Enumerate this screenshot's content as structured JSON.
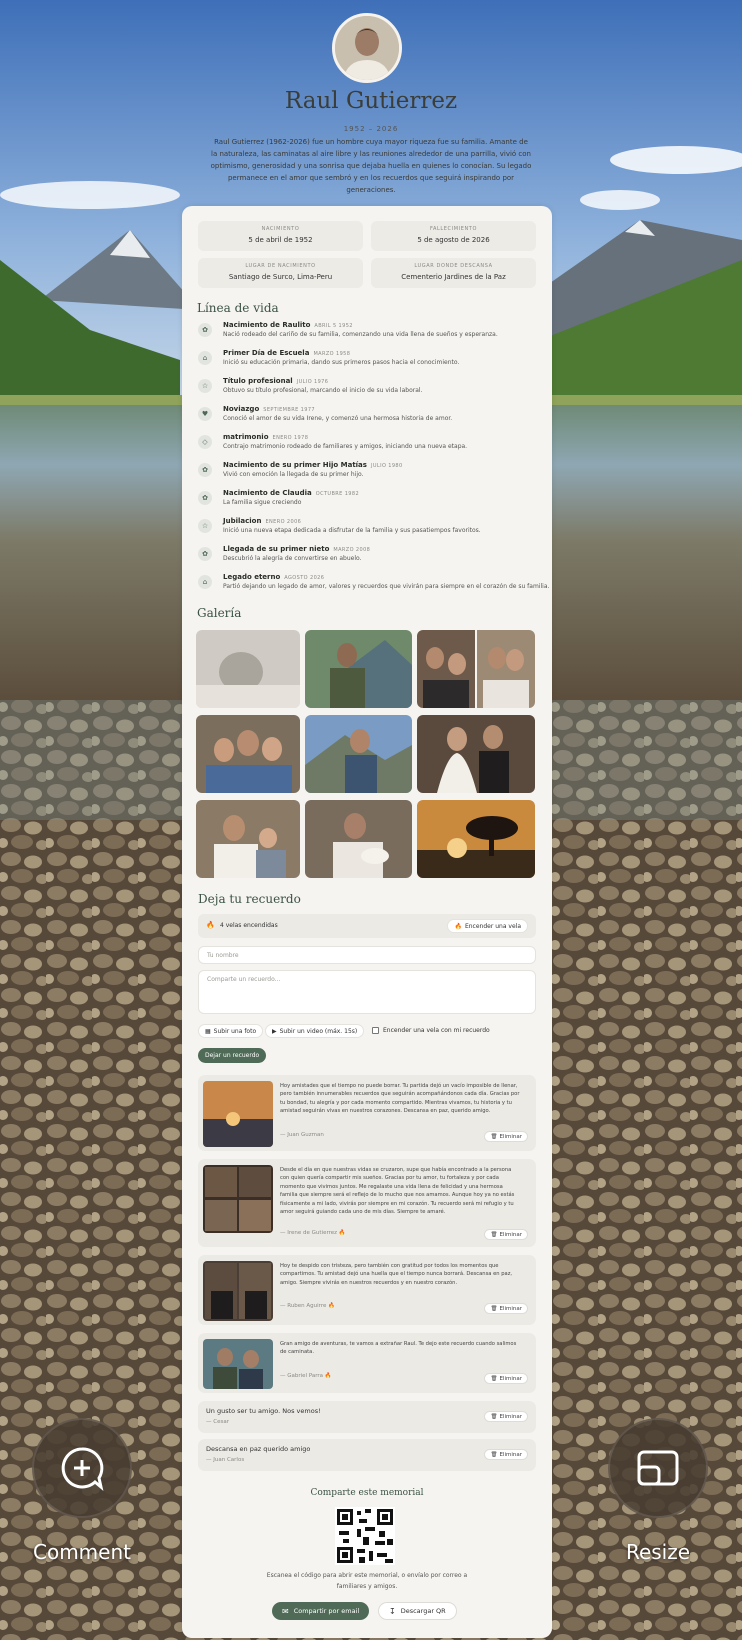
{
  "person": {
    "name": "Raul Gutierrez",
    "years": "1952 – 2026",
    "bio": "Raul Gutierrez (1962-2026) fue un hombre cuya mayor riqueza fue su familia. Amante de la naturaleza, las caminatas al aire libre y las reuniones alrededor de una parrilla, vivió con optimismo, generosidad y una sonrisa que dejaba huella en quienes lo conocían. Su legado permanece en el amor que sembró y en los recuerdos que seguirá inspirando por generaciones."
  },
  "info": [
    {
      "label": "NACIMIENTO",
      "value": "5 de abril de 1952"
    },
    {
      "label": "FALLECIMIENTO",
      "value": "5 de agosto de 2026"
    },
    {
      "label": "LUGAR DE NACIMIENTO",
      "value": "Santiago de Surco, Lima-Peru"
    },
    {
      "label": "LUGAR DONDE DESCANSA",
      "value": "Cementerio Jardines de la Paz"
    }
  ],
  "timeline": {
    "title": "Línea de vida",
    "items": [
      {
        "icon": "✿",
        "icon_name": "baby-icon",
        "title": "Nacimiento de Raulito",
        "date": "ABRIL 5 1952",
        "desc": "Nació rodeado del cariño de su familia, comenzando una vida llena de sueños y esperanza."
      },
      {
        "icon": "⌂",
        "icon_name": "school-icon",
        "title": "Primer Día de Escuela",
        "date": "MARZO 1958",
        "desc": "Inició su educación primaria, dando sus primeros pasos hacia el conocimiento."
      },
      {
        "icon": "☆",
        "icon_name": "star-icon",
        "title": "Título profesional",
        "date": "JULIO 1976",
        "desc": "Obtuvo su título profesional, marcando el inicio de su vida laboral."
      },
      {
        "icon": "♥",
        "icon_name": "hearts-icon",
        "title": "Noviazgo",
        "date": "SEPTIEMBRE 1977",
        "desc": "Conoció el amor de su vida Irene, y comenzó una hermosa historia de amor."
      },
      {
        "icon": "◇",
        "icon_name": "ring-icon",
        "title": "matrimonio",
        "date": "ENERO 1978",
        "desc": "Contrajo matrimonio rodeado de familiares y amigos, iniciando una nueva etapa."
      },
      {
        "icon": "✿",
        "icon_name": "baby-icon",
        "title": "Nacimiento de su primer Hijo Matías",
        "date": "JULIO 1980",
        "desc": "Vivió con emoción la llegada de su primer hijo."
      },
      {
        "icon": "✿",
        "icon_name": "baby-icon",
        "title": "Nacimiento de Claudia",
        "date": "OCTUBRE 1982",
        "desc": "La familia sigue creciendo"
      },
      {
        "icon": "☆",
        "icon_name": "star-icon",
        "title": "Jubilacion",
        "date": "ENERO 2006",
        "desc": "Inició una nueva etapa dedicada a disfrutar de la familia y sus pasatiempos favoritos."
      },
      {
        "icon": "✿",
        "icon_name": "baby-icon",
        "title": "Llegada de su primer nieto",
        "date": "MARZO 2008",
        "desc": "Descubrió la alegría de convertirse en abuelo."
      },
      {
        "icon": "⌂",
        "icon_name": "monument-icon",
        "title": "Legado eterno",
        "date": "AGOSTO 2026",
        "desc": "Partió dejando un legado de amor, valores y recuerdos que vivirán para siempre en el corazón de su familia."
      }
    ]
  },
  "gallery": {
    "title": "Galería"
  },
  "memories": {
    "title": "Deja tu recuerdo",
    "candles_count": "4 velas encendidas",
    "light_candle": "Encender una vela",
    "name_placeholder": "Tu nombre",
    "memory_placeholder": "Comparte un recuerdo...",
    "upload_photo": "Subir una foto",
    "upload_video": "Subir un video (máx. 15s)",
    "candle_with_memory": "Encender una vela con mi recuerdo",
    "submit": "Dejar un recuerdo",
    "delete_label": "Eliminar",
    "entries": [
      {
        "text": "Hoy amistades que el tiempo no puede borrar. Tu partida dejó un vacío imposible de llenar, pero también innumerables recuerdos que seguirán acompañándonos cada día. Gracias por tu bondad, tu alegría y por cada momento compartido. Mientras vivamos, tu historia y tu amistad seguirán vivas en nuestros corazones. Descansa en paz, querido amigo.",
        "author": "— Juan Guzman"
      },
      {
        "text": "Desde el día en que nuestras vidas se cruzaron, supe que había encontrado a la persona con quien quería compartir mis sueños. Gracias por tu amor, tu fortaleza y por cada momento que vivimos juntos. Me regalaste una vida llena de felicidad y una hermosa familia que siempre será el reflejo de lo mucho que nos amamos. Aunque hoy ya no estás físicamente a mi lado, vivirás por siempre en mi corazón. Tu recuerdo será mi refugio y tu amor seguirá guiando cada uno de mis días. Siempre te amaré.",
        "author": "— Irene de Gutierrez"
      },
      {
        "text": "Hoy te despido con tristeza, pero también con gratitud por todos los momentos que compartimos. Tu amistad dejó una huella que el tiempo nunca borrará. Descansa en paz, amigo. Siempre vivirás en nuestros recuerdos y en nuestro corazón.",
        "author": "— Ruben Aguirre"
      },
      {
        "text": "Gran amigo de aventuras, te vamos a extrañar Raul. Te dejo este recuerdo cuando salimos de caminata.",
        "author": "— Gabriel Parra"
      },
      {
        "text": "Un gusto ser tu amigo. Nos vemos!",
        "author": "— Cesar"
      },
      {
        "text": "Descansa en paz querido amigo",
        "author": "— Juan Carlos"
      }
    ]
  },
  "share": {
    "title": "Comparte este memorial",
    "desc": "Escanea el código para abrir este memorial, o envíalo por correo a familiares y amigos.",
    "email_button": "Compartir por email",
    "qr_button": "Descargar QR"
  },
  "overlay": {
    "comment_label": "Comment",
    "resize_label": "Resize"
  },
  "colors": {
    "accent": "#4f6b57",
    "card": "#f5f4f0",
    "candle": "#e8883a"
  }
}
